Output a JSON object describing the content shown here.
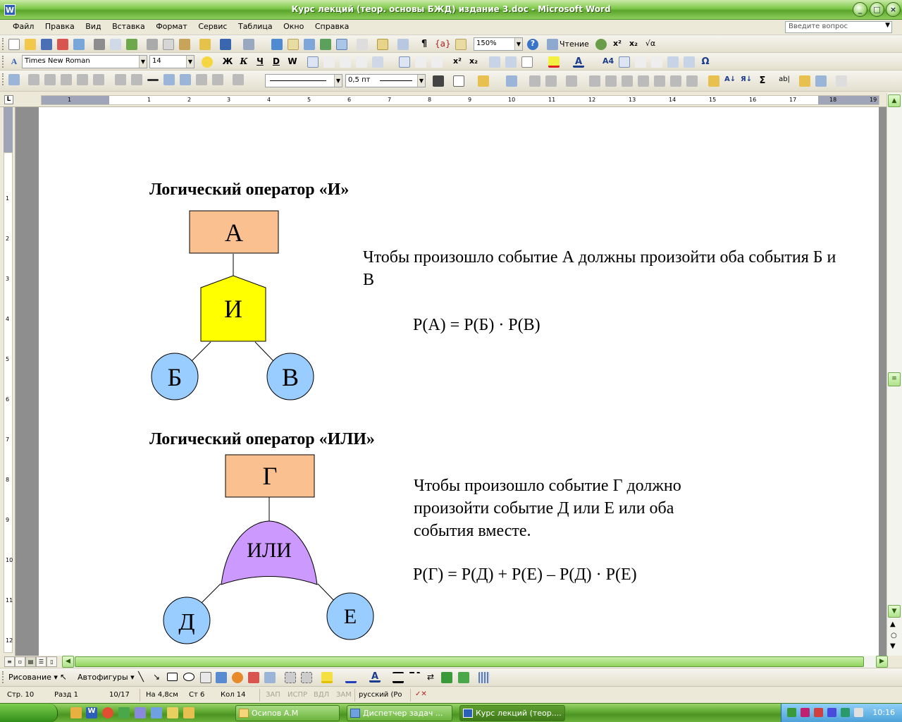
{
  "window": {
    "title": "Курс лекций (теор. основы БЖД) издание 3.doc - Microsoft Word",
    "app_icon": "W"
  },
  "menu": {
    "items": [
      "Файл",
      "Правка",
      "Вид",
      "Вставка",
      "Формат",
      "Сервис",
      "Таблица",
      "Окно",
      "Справка"
    ],
    "ask_placeholder": "Введите вопрос"
  },
  "toolbar": {
    "zoom": "150%",
    "read_label": "Чтение",
    "font_name": "Times New Roman",
    "font_size": "14",
    "line_weight": "0,5 пт"
  },
  "ruler": {
    "h_labels": [
      "1",
      "1",
      "2",
      "3",
      "4",
      "5",
      "6",
      "7",
      "8",
      "9",
      "10",
      "11",
      "12",
      "13",
      "14",
      "15",
      "16",
      "17",
      "18",
      "19"
    ],
    "v_labels": [
      "1",
      "2",
      "3",
      "4",
      "5",
      "6",
      "7",
      "8",
      "9",
      "10",
      "11",
      "12"
    ]
  },
  "document": {
    "and_heading": "Логический оператор «И»",
    "and_top": "А",
    "and_gate": "И",
    "and_left": "Б",
    "and_right": "В",
    "and_desc": "Чтобы произошло событие А должны произойти оба события Б и В",
    "and_formula": "Р(А) = Р(Б) · Р(В)",
    "or_heading": "Логический оператор «ИЛИ»",
    "or_top": "Г",
    "or_gate": "ИЛИ",
    "or_left": "Д",
    "or_right": "Е",
    "or_desc": "Чтобы произошло событие Г должно произойти событие Д или Е или оба события вместе.",
    "or_formula": "Р(Г) = Р(Д) + Р(Е) – Р(Д) · Р(Е)",
    "colors": {
      "rect": "#fac090",
      "and_gate": "#ffff00",
      "or_gate": "#cc99ff",
      "circle": "#99ccff"
    }
  },
  "drawing_toolbar": {
    "draw_label": "Рисование",
    "autoshapes_label": "Автофигуры"
  },
  "status": {
    "page": "Стр. 10",
    "section": "Разд 1",
    "pages": "10/17",
    "at": "На 4,8см",
    "line": "Ст 6",
    "col": "Кол 14",
    "rec": "ЗАП",
    "trk": "ИСПР",
    "ext": "ВДЛ",
    "ovr": "ЗАМ",
    "lang": "русский (Ро"
  },
  "taskbar": {
    "start_label": "",
    "tasks": [
      "Осипов А.М",
      "Диспетчер задач ...",
      "Курс лекций (теор...."
    ],
    "clock": "10:16"
  }
}
